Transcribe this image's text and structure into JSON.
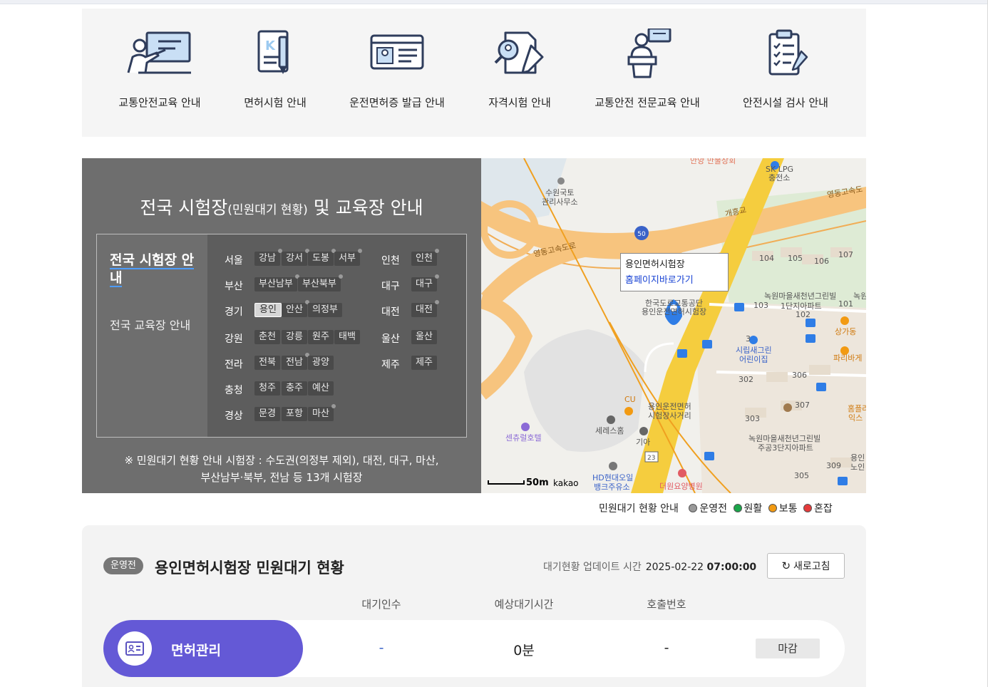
{
  "services": [
    {
      "label": "교통안전교육 안내",
      "icon": "teacher-board-icon"
    },
    {
      "label": "면허시험 안내",
      "icon": "license-book-pencil-icon"
    },
    {
      "label": "운전면허증 발급 안내",
      "icon": "id-card-icon"
    },
    {
      "label": "자격시험 안내",
      "icon": "exam-document-icon"
    },
    {
      "label": "교통안전 전문교육 안내",
      "icon": "lecturer-podium-icon"
    },
    {
      "label": "안전시설 검사 안내",
      "icon": "clipboard-checklist-icon"
    }
  ],
  "panel": {
    "title_main": "전국 시험장",
    "title_sub": "(민원대기 현황)",
    "title_end": " 및 교육장 안내",
    "menu_sites": "전국 시험장 안내",
    "menu_edu": "전국 교육장 안내",
    "note_line1": "※ 민원대기 현황 안내 시험장 : 수도권(의정부 제외), 대전, 대구, 마산,",
    "note_line2": "부산남부·북부, 전남 등 13개 시험장",
    "regions": {
      "seoul": {
        "name": "서울",
        "sites": [
          "강남",
          "강서",
          "도봉",
          "서부"
        ]
      },
      "busan": {
        "name": "부산",
        "sites": [
          "부산남부",
          "부산북부"
        ]
      },
      "gyeonggi": {
        "name": "경기",
        "sites": [
          "용인",
          "안산",
          "의정부"
        ]
      },
      "gangwon": {
        "name": "강원",
        "sites": [
          "춘천",
          "강릉",
          "원주",
          "태백"
        ]
      },
      "jeolla": {
        "name": "전라",
        "sites": [
          "전북",
          "전남",
          "광양"
        ]
      },
      "chungcheong": {
        "name": "충청",
        "sites": [
          "청주",
          "충주",
          "예산"
        ]
      },
      "gyeongsang": {
        "name": "경상",
        "sites": [
          "문경",
          "포항",
          "마산"
        ]
      },
      "incheon": {
        "name": "인천",
        "sites": [
          "인천"
        ]
      },
      "daegu": {
        "name": "대구",
        "sites": [
          "대구"
        ]
      },
      "daejeon": {
        "name": "대전",
        "sites": [
          "대전"
        ]
      },
      "ulsan": {
        "name": "울산",
        "sites": [
          "울산"
        ]
      },
      "jeju": {
        "name": "제주",
        "sites": [
          "제주"
        ]
      }
    },
    "selected_site": "용인"
  },
  "map": {
    "popup_title": "용인면허시험장",
    "popup_link": "홈페이지바로가기",
    "scale": "50m",
    "provider": "kakao",
    "labels": {
      "l1": "안양 만물상회",
      "l2": "SK LPG",
      "l3": "충전소",
      "l4": "수원국토",
      "l5": "관리사무소",
      "l6": "영동고속도",
      "l7": "개흥교",
      "l8": "영동고속도로",
      "l9": "50",
      "l10": "한국도로교통공단",
      "l11": "용인운전면허시험장",
      "l12": "녹원마을새천년그린빌",
      "l13": "1단지아파트",
      "l14": "녹원",
      "l15": "상가동",
      "l16": "시립새그린",
      "l17": "어린이집",
      "l18": "파리바게",
      "l19": "CU",
      "l20": "용인운전면허",
      "l21": "시험장사거리",
      "l22": "세레스홈",
      "l23": "센츄럴호텔",
      "l24": "기아",
      "l25": "녹원마을새천년그린빌",
      "l26": "주공3단지아파트",
      "l27": "HD현대오일",
      "l28": "뱅크주유소",
      "l29": "더원요양병원",
      "l30": "홈플러",
      "l31": "익스",
      "l32": "용인",
      "l33": "노인",
      "l34": "23",
      "n104": "104",
      "n105": "105",
      "n106": "106",
      "n107": "107",
      "n103": "103",
      "n101": "101",
      "n102": "102",
      "n302": "302",
      "n306": "306",
      "n307": "307",
      "n303": "303",
      "n309": "309",
      "n305": "305",
      "n3": "3"
    }
  },
  "legend": {
    "title": "민원대기 현황 안내",
    "items": [
      {
        "label": "운영전",
        "color": "#999999"
      },
      {
        "label": "원활",
        "color": "#1aa64a"
      },
      {
        "label": "보통",
        "color": "#f29a12"
      },
      {
        "label": "혼잡",
        "color": "#e53b3b"
      }
    ]
  },
  "status": {
    "badge": "운영전",
    "title": "용인면허시험장 민원대기 현황",
    "update_label": "대기현황 업데이트 시간",
    "update_date": "2025-02-22",
    "update_time": "07:00:00",
    "refresh": "새로고침",
    "columns": [
      "대기인수",
      "예상대기시간",
      "호출번호"
    ],
    "row": {
      "name": "면허관리",
      "waiting": "-",
      "wait_time": "0분",
      "call_no": "-",
      "state": "마감"
    }
  }
}
